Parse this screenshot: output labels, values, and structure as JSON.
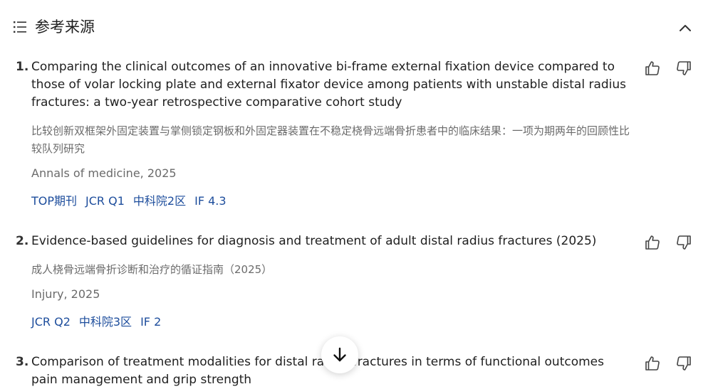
{
  "header": {
    "title": "参考来源",
    "list_icon": "list-icon",
    "collapse_icon": "chevron-up-icon"
  },
  "references": [
    {
      "number": "1.",
      "title": "Comparing the clinical outcomes of an innovative bi-frame external fixation device compared to those of volar locking plate and external fixator device among patients with unstable distal radius fractures: a two-year retrospective comparative cohort study",
      "translation": "比较创新双框架外固定装置与掌侧锁定钢板和外固定器装置在不稳定桡骨远端骨折患者中的临床结果：一项为期两年的回顾性比较队列研究",
      "source": "Annals of medicine, 2025",
      "tags": [
        "TOP期刊",
        "JCR Q1",
        "中科院2区",
        "IF 4.3"
      ]
    },
    {
      "number": "2.",
      "title": "Evidence-based guidelines for diagnosis and treatment of adult distal radius fractures (2025)",
      "translation": "成人桡骨远端骨折诊断和治疗的循证指南（2025）",
      "source": "Injury, 2025",
      "tags": [
        "JCR Q2",
        "中科院3区",
        "IF 2"
      ]
    },
    {
      "number": "3.",
      "title": "Comparison of treatment modalities for distal radius fractures in terms of functional outcomes pain management and grip strength"
    }
  ],
  "icons": {
    "like": "thumbs-up-icon",
    "dislike": "thumbs-down-icon",
    "scroll": "arrow-down-icon"
  },
  "colors": {
    "tag": "#1d4d9c",
    "secondary_text": "#6b6b6b"
  }
}
